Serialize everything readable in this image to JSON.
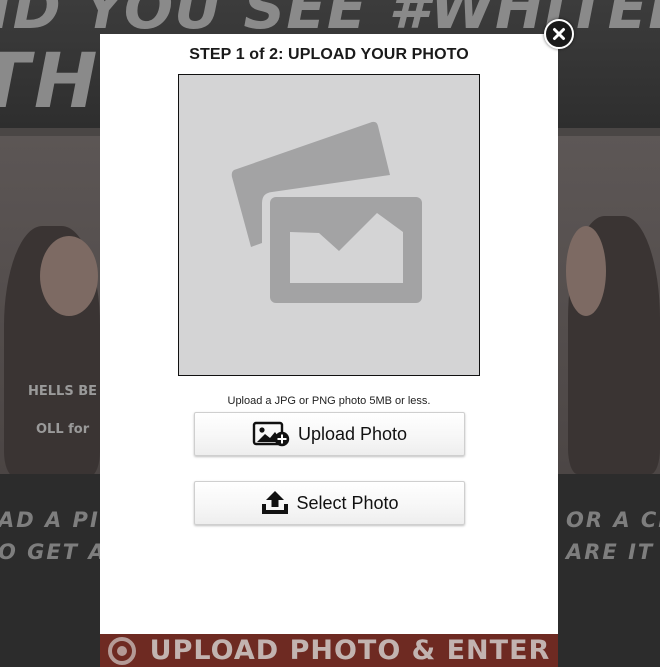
{
  "background": {
    "headline_line1": "ID YOU SEE #WHITELIGHTNING",
    "headline_line2": "TH         ER?",
    "shirt_text_1": "HELLS BE",
    "shirt_text_2": "OLL for",
    "lower_left_1": "AD A PIC",
    "lower_left_2": "O GET A C",
    "lower_right_1": "OR A CH",
    "lower_right_2": "ARE IT O",
    "cta_label": "UPLOAD PHOTO & ENTER"
  },
  "modal": {
    "title": "STEP 1 of 2: UPLOAD YOUR PHOTO",
    "hint": "Upload a JPG or PNG photo 5MB or less.",
    "upload_button_label": "Upload Photo",
    "select_button_label": "Select Photo"
  },
  "icons": {
    "close": "close-icon",
    "placeholder": "image-placeholder-icon",
    "upload": "add-image-icon",
    "select": "upload-tray-icon"
  },
  "colors": {
    "modal_bg": "#ffffff",
    "preview_bg": "#d4d4d5",
    "placeholder_gray": "#a3a3a4",
    "cta_red": "#6e2a22"
  }
}
